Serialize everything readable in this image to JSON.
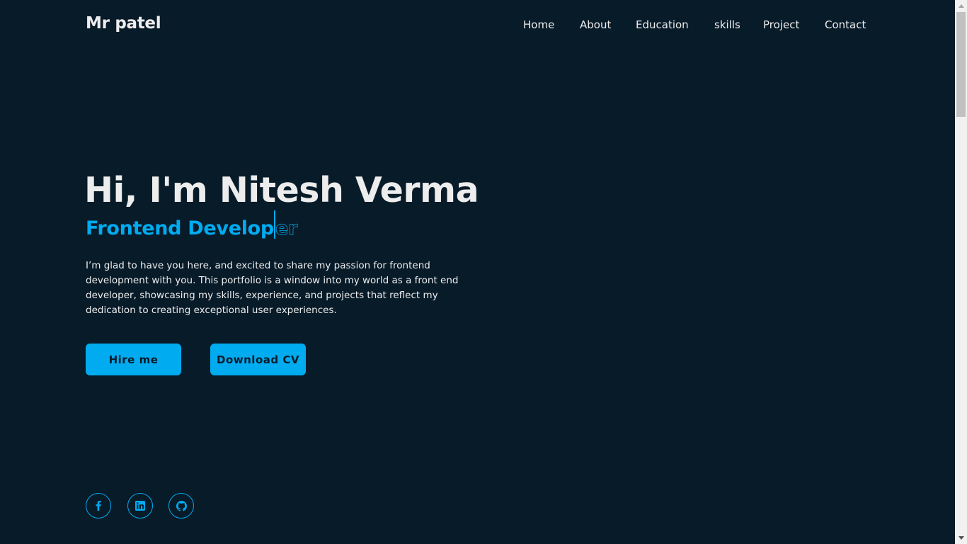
{
  "header": {
    "logo": "Mr patel",
    "nav": [
      "Home",
      "About",
      "Education",
      "skills",
      "Project",
      "Contact"
    ]
  },
  "hero": {
    "title": "Hi, I'm Nitesh Verma",
    "role_typed": "Frontend Develop",
    "role_remaining": "er",
    "description": "I’m glad to have you here, and excited to share my passion for frontend development with you. This portfolio is a window into my world as a front end developer, showcasing my skills, experience, and projects that reflect my dedication to creating exceptional user experiences.",
    "buttons": {
      "hire": "Hire me",
      "cv": "Download CV"
    }
  },
  "social": [
    "facebook-icon",
    "linkedin-icon",
    "github-icon"
  ],
  "colors": {
    "background": "#081b29",
    "accent": "#00abf0",
    "text": "#ededed"
  }
}
